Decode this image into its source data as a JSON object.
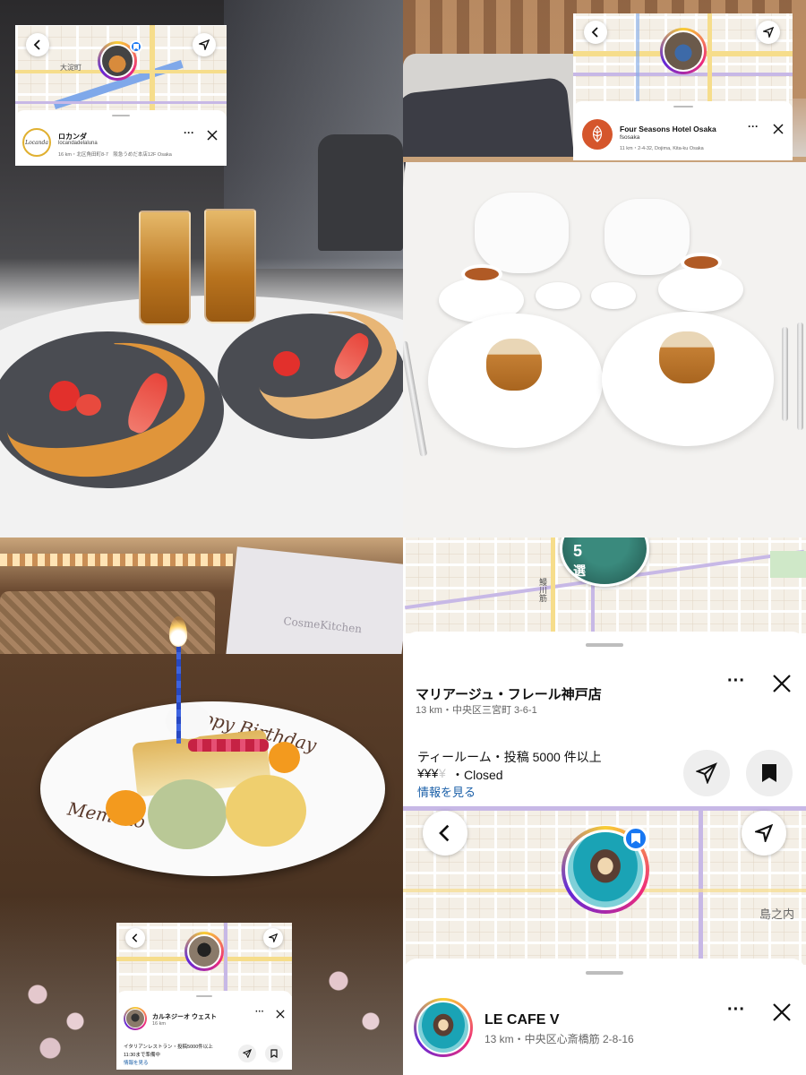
{
  "panel1": {
    "map_label": "大淀町",
    "place_name": "ロカンダ",
    "handle": "locandadelaluna",
    "meta": "16 km・北区角田町8-7　阪急うめだ本店12F Osaka",
    "logo_text": "Locanda",
    "colors": {
      "accent_blue": "#1877f2"
    }
  },
  "panel2": {
    "place_name": "Four Seasons Hotel Osaka",
    "handle": "fsosaka",
    "meta": "11 km・2-4-32, Dojima, Kita-ku Osaka"
  },
  "panel3": {
    "plate_text_top": "Happy Birthday",
    "plate_text_name": "Memoko",
    "bag_text": "CosmeKitchen",
    "place_name": "カルネジーオ ウェスト",
    "distance": "16 km",
    "category": "イタリアンレストラン・投稿5000件以上",
    "hours": "11:30まで準備中",
    "info_link": "情報を見る"
  },
  "panel4": {
    "top_map_label": "鰻川筋",
    "badge_number": "5",
    "badge_suffix": "選",
    "place_name": "マリアージュ・フレール神戸店",
    "meta": "13 km・中央区三宮町 3-6-1",
    "category": "ティールーム・投稿 5000 件以上",
    "price_active": "¥¥¥",
    "price_inactive": "¥",
    "status": "・Closed",
    "info_link": "情報を見る",
    "map_label_2": "島之内",
    "bottom_place_name": "LE CAFE V",
    "bottom_meta": "13 km・中央区心斎橋筋 2-8-16"
  }
}
